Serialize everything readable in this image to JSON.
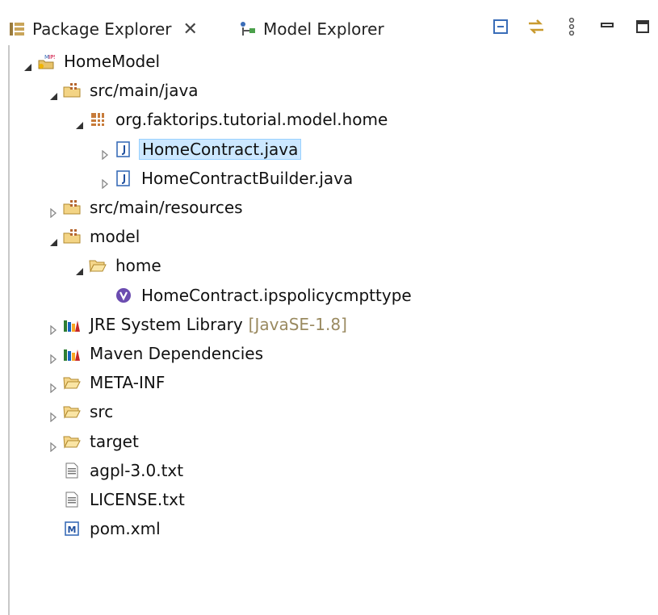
{
  "tabs": {
    "active": {
      "label": "Package Explorer",
      "icon": "package-explorer-icon",
      "close": "✕"
    },
    "inactive": {
      "label": "Model Explorer",
      "icon": "model-explorer-icon"
    }
  },
  "toolbar": {
    "collapse_all": "collapse-all-icon",
    "link_with_editor": "link-with-editor-icon",
    "view_menu": "view-menu-icon",
    "minimize": "minimize-icon",
    "maximize": "maximize-icon"
  },
  "tree": [
    {
      "label": "HomeModel",
      "icon": "faktorips-project-icon",
      "expanded": true,
      "depth": 0
    },
    {
      "label": "src/main/java",
      "icon": "source-folder-icon",
      "expanded": true,
      "depth": 1
    },
    {
      "label": "org.faktorips.tutorial.model.home",
      "icon": "package-icon",
      "expanded": true,
      "depth": 2
    },
    {
      "label": "HomeContract.java",
      "icon": "java-file-icon",
      "expanded": false,
      "selected": true,
      "depth": 3
    },
    {
      "label": "HomeContractBuilder.java",
      "icon": "java-file-icon",
      "expanded": false,
      "depth": 3
    },
    {
      "label": "src/main/resources",
      "icon": "source-folder-icon",
      "expanded": false,
      "depth": 1
    },
    {
      "label": "model",
      "icon": "source-folder-icon",
      "expanded": true,
      "depth": 1
    },
    {
      "label": "home",
      "icon": "folder-open-icon",
      "expanded": true,
      "depth": 2
    },
    {
      "label": "HomeContract.ipspolicycmpttype",
      "icon": "policy-cmpt-type-icon",
      "leaf": true,
      "depth": 3
    },
    {
      "label": "JRE System Library",
      "decor": "[JavaSE-1.8]",
      "icon": "library-icon",
      "expanded": false,
      "depth": 1
    },
    {
      "label": "Maven Dependencies",
      "icon": "library-icon",
      "expanded": false,
      "depth": 1
    },
    {
      "label": "META-INF",
      "icon": "folder-icon",
      "expanded": false,
      "depth": 1
    },
    {
      "label": "src",
      "icon": "folder-icon",
      "expanded": false,
      "depth": 1
    },
    {
      "label": "target",
      "icon": "folder-icon",
      "expanded": false,
      "depth": 1
    },
    {
      "label": "agpl-3.0.txt",
      "icon": "text-file-icon",
      "leaf": true,
      "depth": 1
    },
    {
      "label": "LICENSE.txt",
      "icon": "text-file-icon",
      "leaf": true,
      "depth": 1
    },
    {
      "label": "pom.xml",
      "icon": "maven-pom-icon",
      "leaf": true,
      "depth": 1
    }
  ]
}
